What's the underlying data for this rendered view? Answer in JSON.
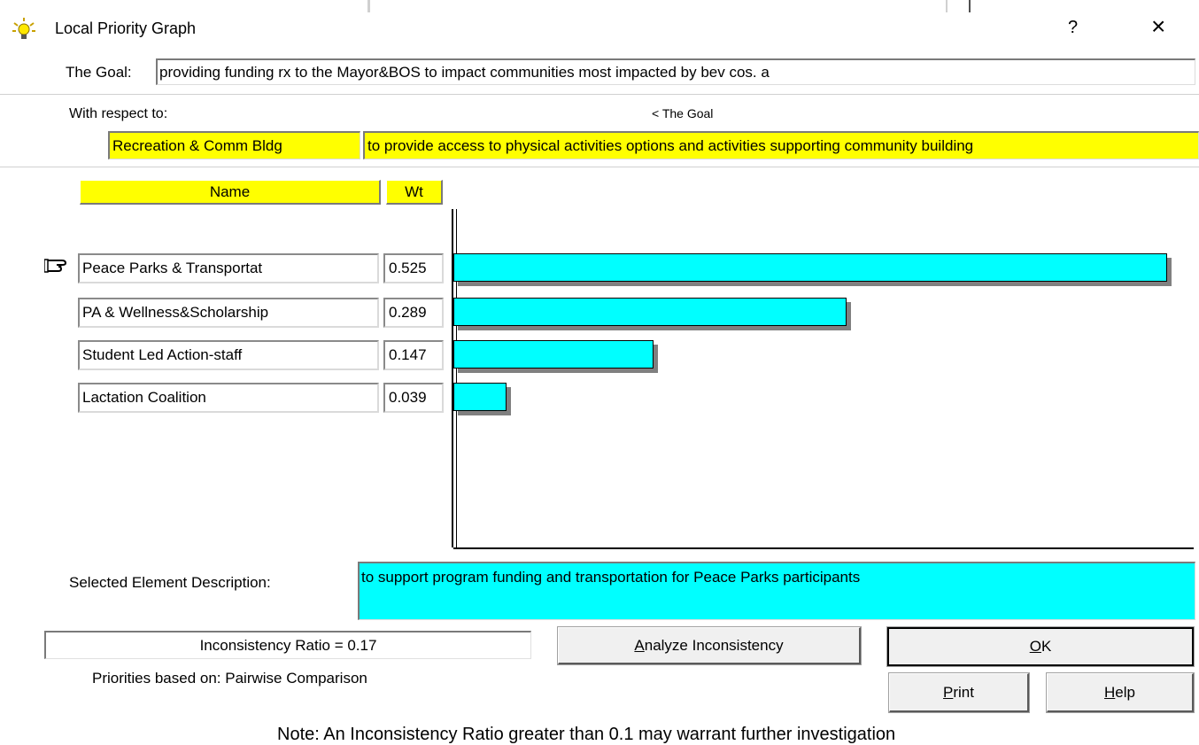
{
  "window": {
    "title": "Local Priority Graph",
    "help_glyph": "?",
    "close_glyph": "×"
  },
  "goal": {
    "label": "The Goal:",
    "value": "providing funding rx to the Mayor&BOS to impact communities most impacted by bev cos. a"
  },
  "respect": {
    "label": "With respect to:",
    "path": "< The Goal",
    "node_name": "Recreation & Comm Bldg",
    "node_desc": "to provide access to physical activities options and activities supporting community building"
  },
  "headers": {
    "name": "Name",
    "wt": "Wt"
  },
  "chart_data": {
    "type": "bar",
    "categories": [
      "Peace Parks & Transportat",
      "PA & Wellness&Scholarship",
      "Student Led Action-staff",
      "Lactation Coalition"
    ],
    "values": [
      "0.525",
      "0.289",
      "0.147",
      "0.039"
    ],
    "bar_color": "#00ffff",
    "selected_index": 0
  },
  "selected": {
    "label": "Selected Element Description:",
    "text": "to support program funding and transportation for Peace Parks participants"
  },
  "inconsistency": {
    "text": "Inconsistency Ratio = 0.17"
  },
  "priorities_basis": "Priorities based on:  Pairwise Comparison",
  "buttons": {
    "analyze": {
      "mn": "A",
      "rest": "nalyze Inconsistency"
    },
    "ok": {
      "mn": "O",
      "rest": "K"
    },
    "print": {
      "mn": "P",
      "rest": "rint"
    },
    "help": {
      "mn": "H",
      "rest": "elp"
    }
  },
  "note": "Note: An Inconsistency Ratio greater than 0.1 may warrant further investigation",
  "icons": {
    "title": "lightbulb-icon",
    "pointer": "pointing-hand-icon"
  }
}
